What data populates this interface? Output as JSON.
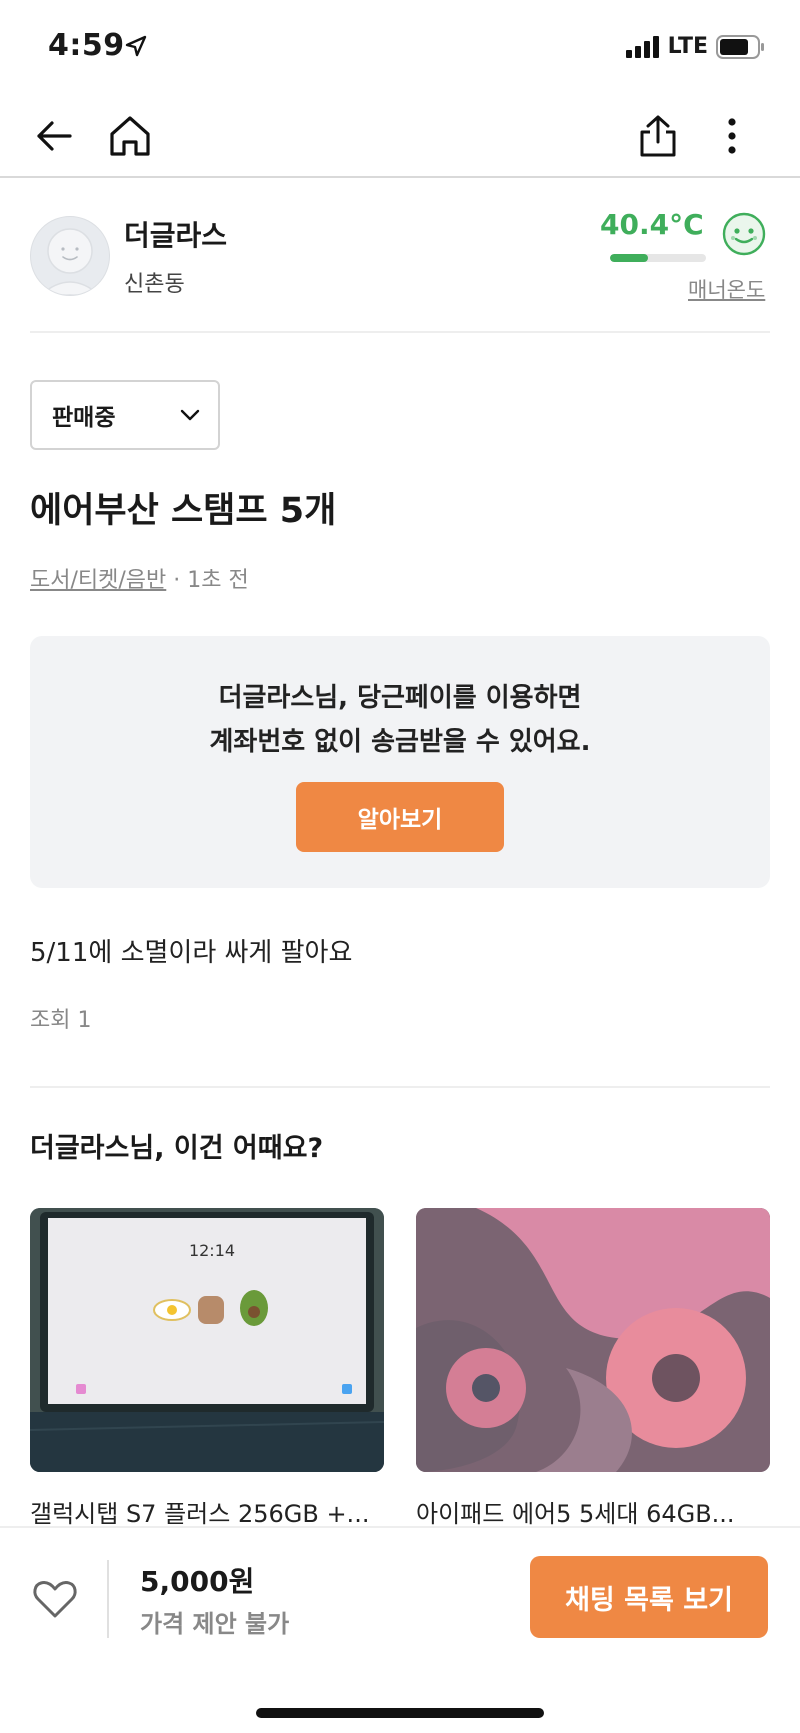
{
  "status_bar": {
    "time": "4:59",
    "network": "LTE"
  },
  "seller": {
    "name": "더글라스",
    "location": "신촌동",
    "temperature": "40.4°C",
    "temperature_level": 0.4,
    "manner_label": "매너온도",
    "temp_color": "#3fae5b"
  },
  "listing": {
    "status": "판매중",
    "title": "에어부산 스탬프 5개",
    "category": "도서/티켓/음반",
    "time_ago": " · 1초 전",
    "description": "5/11에 소멸이라 싸게 팔아요",
    "views": "조회 1"
  },
  "pay_promo": {
    "line1": "더글라스님, 당근페이를 이용하면",
    "line2": "계좌번호 없이 송금받을 수 있어요.",
    "button": "알아보기"
  },
  "recommendations": {
    "title": "더글라스님, 이건 어때요?",
    "items": [
      {
        "title": "갤럭시탭 S7 플러스 256GB +...",
        "screen_time": "12:14"
      },
      {
        "title": "아이패드 에어5 5세대 64GB..."
      }
    ]
  },
  "bottom_bar": {
    "price": "5,000원",
    "price_note": "가격 제안 불가",
    "chat_button": "채팅 목록 보기"
  },
  "colors": {
    "accent": "#ef8844",
    "temperature": "#3fae5b"
  }
}
